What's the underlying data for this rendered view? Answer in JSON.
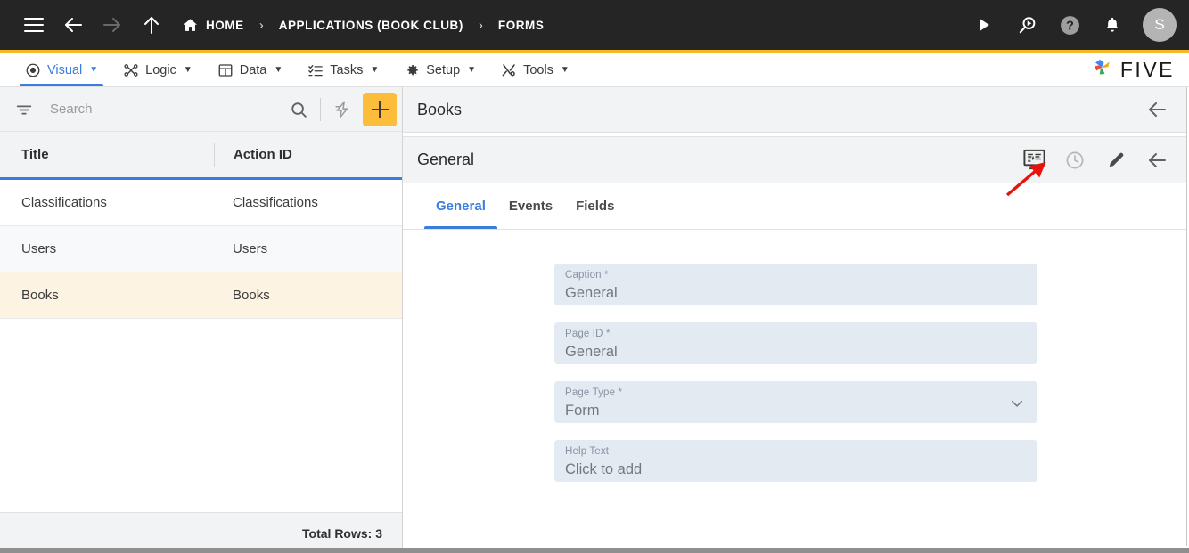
{
  "topbar": {
    "menu_icon": "hamburger-icon",
    "back_icon": "arrow-left-icon",
    "forward_icon": "arrow-right-icon",
    "up_icon": "arrow-up-icon",
    "breadcrumbs": [
      {
        "label": "HOME",
        "icon": "home-icon"
      },
      {
        "label": "APPLICATIONS (BOOK CLUB)",
        "icon": ""
      },
      {
        "label": "FORMS",
        "icon": ""
      }
    ],
    "separator": "›",
    "actions": [
      {
        "name": "run-icon",
        "label": ""
      },
      {
        "name": "search-run-icon",
        "label": ""
      },
      {
        "name": "help-icon",
        "label": "?"
      },
      {
        "name": "notifications-bell-icon",
        "label": ""
      }
    ],
    "avatar_initial": "S",
    "bg_color": "#252525",
    "accent_color": "#f5b927"
  },
  "menubar": {
    "items": [
      {
        "label": "Visual",
        "icon": "eye-icon",
        "caret": "▼",
        "active": true
      },
      {
        "label": "Logic",
        "icon": "logic-nodes-icon",
        "caret": "▼",
        "active": false
      },
      {
        "label": "Data",
        "icon": "table-grid-icon",
        "caret": "▼",
        "active": false
      },
      {
        "label": "Tasks",
        "icon": "task-list-icon",
        "caret": "▼",
        "active": false
      },
      {
        "label": "Setup",
        "icon": "gear-icon",
        "caret": "▼",
        "active": false
      },
      {
        "label": "Tools",
        "icon": "tools-wrench-icon",
        "caret": "▼",
        "active": false
      }
    ],
    "brand": {
      "text": "FIVE",
      "icon": "five-pinwheel-logo"
    },
    "active_color": "#3b7ddd"
  },
  "sidebar": {
    "search": {
      "placeholder": "Search",
      "value": ""
    },
    "filter_icon": "filter-icon",
    "search_icon": "search-icon",
    "bolt_icon": "lightning-bolt-icon",
    "add_label": "+",
    "columns": [
      "Title",
      "Action ID"
    ],
    "rows": [
      {
        "title": "Classifications",
        "action_id": "Classifications",
        "selected": false
      },
      {
        "title": "Users",
        "action_id": "Users",
        "selected": false
      },
      {
        "title": "Books",
        "action_id": "Books",
        "selected": true
      }
    ],
    "footer": "Total Rows: 3",
    "selected_row_color": "#fdf3e2"
  },
  "main": {
    "pane_title": "Books",
    "pane_back_icon": "arrow-left-icon",
    "sub_title": "General",
    "sub_tools": [
      {
        "name": "form-designer-monitor-icon"
      },
      {
        "name": "history-clock-icon"
      },
      {
        "name": "edit-pencil-icon"
      },
      {
        "name": "arrow-left-icon"
      }
    ],
    "tabs": [
      {
        "label": "General",
        "active": true
      },
      {
        "label": "Events",
        "active": false
      },
      {
        "label": "Fields",
        "active": false
      }
    ],
    "fields": [
      {
        "label": "Caption",
        "required": " *",
        "value": "General",
        "type": "text"
      },
      {
        "label": "Page ID",
        "required": " *",
        "value": "General",
        "type": "text"
      },
      {
        "label": "Page Type",
        "required": " *",
        "value": "Form",
        "type": "select"
      },
      {
        "label": "Help Text",
        "required": "",
        "value": "Click to add",
        "type": "text"
      }
    ],
    "field_bg_color": "#e3eaf2"
  },
  "annotation": {
    "type": "red-arrow",
    "color": "#e8120c",
    "points_to": "form-designer-monitor-icon"
  }
}
